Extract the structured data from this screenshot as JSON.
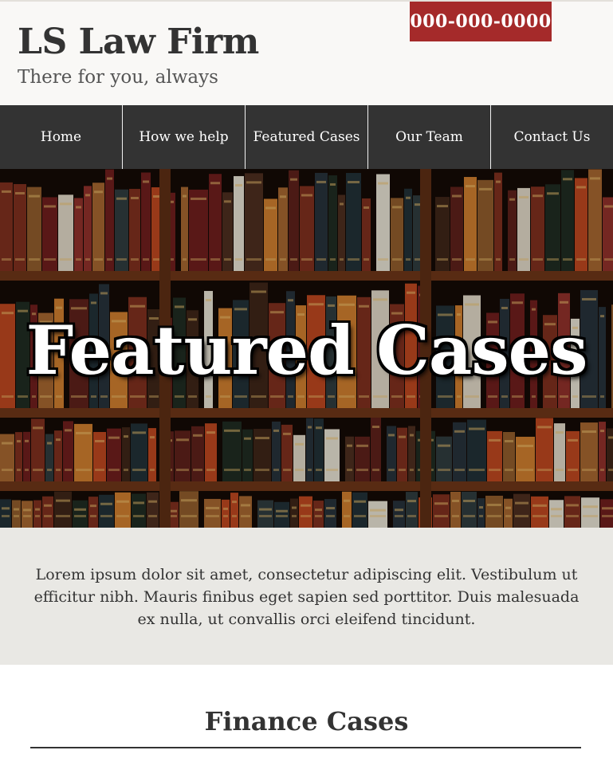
{
  "header": {
    "title": "LS Law Firm",
    "tagline": "There for you, always",
    "phone": "000-000-0000"
  },
  "nav": {
    "items": [
      {
        "label": "Home"
      },
      {
        "label": "How we help"
      },
      {
        "label": "Featured Cases"
      },
      {
        "label": "Our Team"
      },
      {
        "label": "Contact Us"
      }
    ]
  },
  "hero": {
    "title": "Featured Cases",
    "image": "bookshelf-photo"
  },
  "intro": {
    "text": "Lorem ipsum dolor sit amet, consectetur adipiscing elit. Vestibulum ut efficitur nibh. Mauris finibus eget sapien sed porttitor. Duis malesuada ex nulla, ut convallis orci eleifend tincidunt."
  },
  "section": {
    "title": "Finance Cases"
  },
  "colors": {
    "header_bg": "#f9f8f6",
    "phone_bg": "#a52a2a",
    "nav_bg": "#333333",
    "intro_bg": "#e9e8e4",
    "text": "#333333"
  }
}
